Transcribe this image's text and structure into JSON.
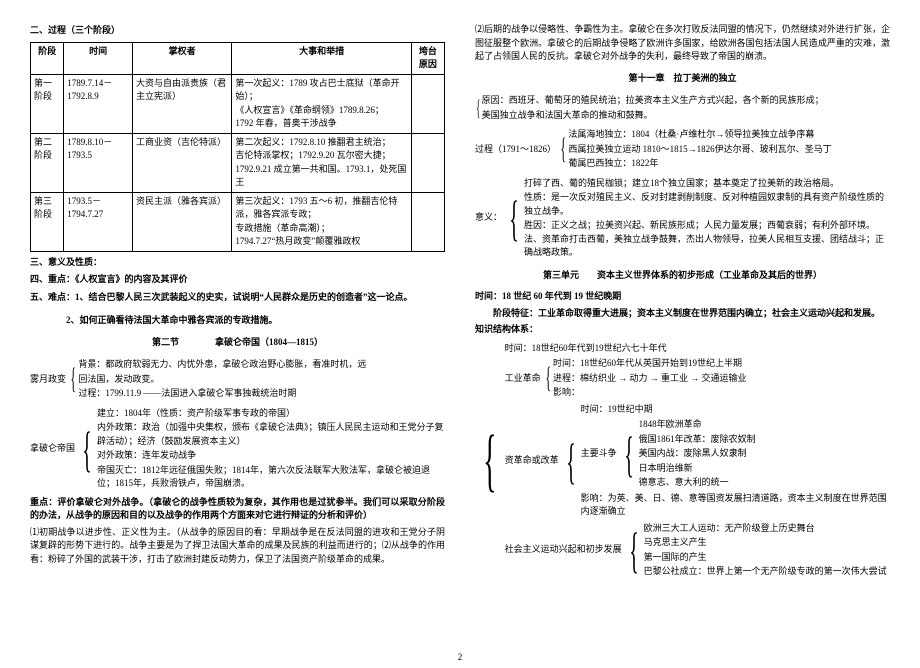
{
  "left": {
    "title_process": "二、过程（三个阶段）",
    "table": {
      "headers": [
        "阶段",
        "时间",
        "掌权者",
        "大事和举措",
        "垮台原因"
      ],
      "rows": [
        {
          "phase": "第一阶段",
          "time": "1789.7.14－1792.8.9",
          "holder": "大资与自由派贵族（君主立宪派）",
          "events": "第一次起义：1789 攻占巴士底狱（革命开始）；\n《人权宣言》《革命纲领》1789.8.26；\n1792 年春，普奥干涉战争",
          "reason": ""
        },
        {
          "phase": "第二阶段",
          "time": "1789.8.10－1793.5",
          "holder": "工商业资（吉伦特派）",
          "events": "第二次起义：1792.8.10 推翻君主统治；\n吉伦特派掌权；1792.9.20 瓦尔密大捷；\n1792.9.21 成立第一共和国。1793.1，处死国王",
          "reason": ""
        },
        {
          "phase": "第三阶段",
          "time": "1793.5－1794.7.27",
          "holder": "资民主派（雅各宾派）",
          "events": "第三次起义：1793 五～6 初，推翻吉伦特派，雅各宾派专政；\n专政措施（革命高潮）；\n1794.7.27“热月政变”颠覆雅政权",
          "reason": ""
        }
      ]
    },
    "h3": "三、意义及性质：",
    "h4": "四、重点：《人权宣言》的内容及其评价",
    "h5a": "五、难点：1、结合巴黎人民三次武装起义的史实，试说明“人民群众是历史的创造者”这一论点。",
    "h5b": "2、如何正确看待法国大革命中雅各宾派的专政措施。",
    "section2_title": "第二节　　　　拿破仑帝国（1804—1815）",
    "bg_label": "雾月政变",
    "bg_lines": [
      "背景：都政府软弱无力、内忧外患，拿破仑政治野心膨胀，看准时机，远",
      "回法国，发动政变。",
      "过程：1799.11.9 ——法国进入拿破仑军事独裁统治时期"
    ],
    "empire_label": "拿破仑帝国",
    "empire_lines": [
      "建立：1804年（性质：资产阶级军事专政的帝国）",
      "内外政策：政治（加强中央集权，颁布《拿破仑法典》；镇压人民民主运动和王党分子复辟活动）；经济（鼓励发展资本主义）",
      "对外政策：连年发动战争",
      "帝国灭亡：1812年远征俄国失败；1814年，第六次反法联军大败法军，拿破仑被迫退位；1815年，兵败滑铁卢，帝国崩溃。"
    ],
    "focus_para": "重点：评价拿破仑对外战争。（拿破仑的战争性质较为复杂，其作用也是过犹参半。我们可以采取分阶段的办法，从战争的原因和目的以及战争的作用两个方面来对它进行辩证的分析和评价）",
    "p1": "⑴初期战争以进步性、正义性为主。（从战争的原因目的看：早期战争是在反法同盟的进攻和王党分子阴谋复辟的形势下进行的。战争主要是为了捍卫法国大革命的成果及民族的利益而进行的；⑵从战争的作用看：粉碎了外国的武装干涉，打击了欧洲封建反动势力，保卫了法国资产阶级革命的成果。"
  },
  "right": {
    "p2": "⑵后期的战争以侵略性、争霸性为主。拿破仑在多次打败反法同盟的情况下，仍然继续对外进行扩张，企图征服整个欧洲。拿破仑的后期战争侵略了欧洲许多国家，给欧洲各国包括法国人民造成严重的灾难，激起了占领国人民的反抗。拿破仑对外战争的失利，最终导致了帝国的崩溃。",
    "ch11_title": "第十一章　拉丁美洲的独立",
    "cause_lines": [
      "原因：西班牙、葡萄牙的殖民统治；拉美资本主义生产方式兴起，各个新的民族形成；",
      "美国独立战争和法国大革命的推动和鼓舞。"
    ],
    "proc_label": "过程（1791～1826）",
    "proc_lines": [
      "法属海地独立：1804（杜桑·卢维杜尔→领导拉美独立战争序幕",
      "西属拉美独立运动 1810～1815→1826伊达尔哥、玻利瓦尔、圣马丁",
      "葡属巴西独立：1822年"
    ],
    "meaning_label": "意义：",
    "meaning_lines": [
      "打碎了西、葡的殖民枷锁；建立18个独立国家；基本奠定了拉美新的政治格局。",
      "性质：是一次反对殖民主义、反对封建剥削制度、反对种植园奴隶制的具有资产阶级性质的独立战争。",
      "胜因：正义之战；拉美资兴起、新民族形成；人民力量发展；西葡衰弱；有利外部环境。法、资革命打击西葡，美独立战争鼓舞，杰出人物领导，拉美人民相互支援、团结战斗；正确战略政策。"
    ],
    "unit3_title": "第三单元　　资本主义世界体系的初步形成（工业革命及其后的世界）",
    "time_line_hdr": "时间：18 世纪 60 年代到 19 世纪晚期",
    "feat": "阶段特征：工业革命取得重大进展；资本主义制度在世界范围内确立；社会主义运动兴起和发展。",
    "struct_hdr": "知识结构体系：",
    "struct": {
      "time": "时间：18世纪60年代到19世纪六七十年代",
      "ind_label": "工业革命",
      "ind_lines": [
        "时间：18世纪60年代从英国开始到19世纪上半期",
        "进程：棉纺织业 → 动力 → 重工业 → 交通运输业",
        "影响："
      ],
      "reform_label": "资革命或改革",
      "reform_time": "时间：19世纪中期",
      "reform_fight_label": "主要斗争",
      "reform_fight": [
        "1848年欧洲革命",
        "俄国1861年改革：废除农奴制",
        "美国内战：废除黑人奴隶制",
        "日本明治维新",
        "德意志、意大利的统一"
      ],
      "reform_effect": "影响：为英、美、日、德、意等国资发展扫清道路，资本主义制度在世界范围内逐渐确立",
      "soc_label": "社会主义运动兴起和初步发展",
      "soc_lines": [
        "欧洲三大工人运动：无产阶级登上历史舞台",
        "马克思主义产生",
        "第一国际的产生",
        "巴黎公社成立：世界上第一个无产阶级专政的第一次伟大尝试"
      ]
    }
  },
  "page_num": "2"
}
